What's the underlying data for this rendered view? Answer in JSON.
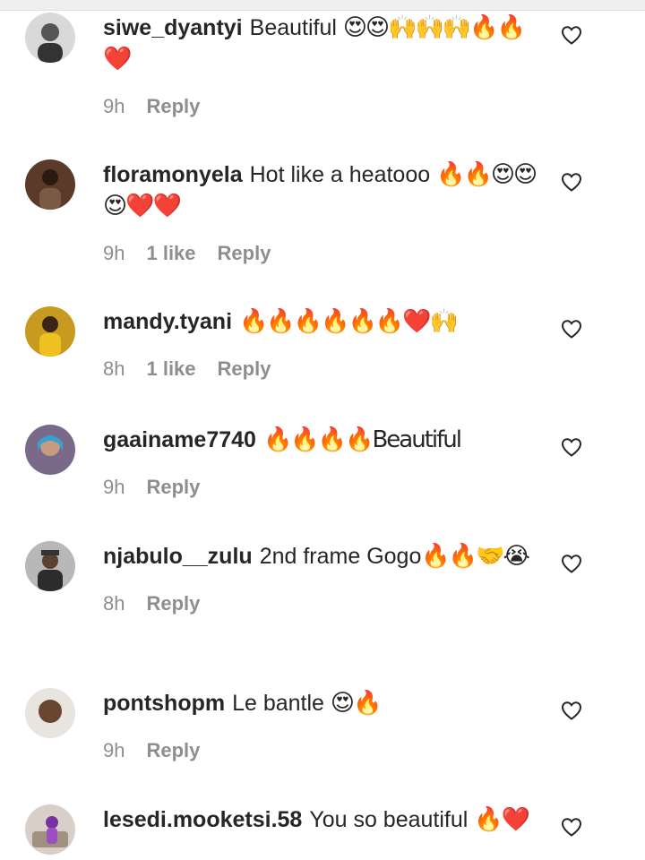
{
  "comments": [
    {
      "username": "siwe_dyantyi",
      "text": "Beautiful ",
      "emoji": "😍😍🙌🙌🙌🔥🔥❤️",
      "time": "9h",
      "likes": "",
      "reply": "Reply"
    },
    {
      "username": "floramonyela",
      "text": "Hot like a heatooo ",
      "emoji": "🔥🔥😍😍😍❤️❤️",
      "time": "9h",
      "likes": "1 like",
      "reply": "Reply"
    },
    {
      "username": "mandy.tyani",
      "text": "",
      "emoji": "🔥🔥🔥🔥🔥🔥❤️🙌",
      "time": "8h",
      "likes": "1 like",
      "reply": "Reply"
    },
    {
      "username": "gaainame7740",
      "text": "",
      "emoji": "🔥🔥🔥🔥Beautiful",
      "time": "9h",
      "likes": "",
      "reply": "Reply"
    },
    {
      "username": "njabulo__zulu",
      "text": "2nd frame Gogo",
      "emoji": "🔥🔥🤝😭",
      "time": "8h",
      "likes": "",
      "reply": "Reply"
    },
    {
      "username": "pontshopm",
      "text": "Le bantle ",
      "emoji": "😍🔥",
      "time": "9h",
      "likes": "",
      "reply": "Reply"
    },
    {
      "username": "lesedi.mooketsi.58",
      "text": "You so beautiful ",
      "emoji": "🔥❤️",
      "time": "",
      "likes": "",
      "reply": ""
    }
  ],
  "icons": {
    "like": "heart-outline-icon",
    "avatar": "user-avatar"
  },
  "colors": {
    "text": "#262626",
    "meta": "#8e8e8e",
    "background": "#ffffff"
  }
}
